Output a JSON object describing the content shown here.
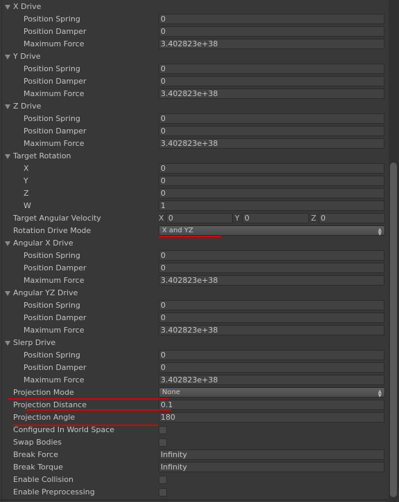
{
  "rows": [
    {
      "type": "foldout",
      "label": "X Drive"
    },
    {
      "type": "field",
      "label": "Position Spring",
      "value": "0"
    },
    {
      "type": "field",
      "label": "Position Damper",
      "value": "0"
    },
    {
      "type": "field",
      "label": "Maximum Force",
      "value": "3.402823e+38"
    },
    {
      "type": "foldout",
      "label": "Y Drive"
    },
    {
      "type": "field",
      "label": "Position Spring",
      "value": "0"
    },
    {
      "type": "field",
      "label": "Position Damper",
      "value": "0"
    },
    {
      "type": "field",
      "label": "Maximum Force",
      "value": "3.402823e+38"
    },
    {
      "type": "foldout",
      "label": "Z Drive"
    },
    {
      "type": "field",
      "label": "Position Spring",
      "value": "0"
    },
    {
      "type": "field",
      "label": "Position Damper",
      "value": "0"
    },
    {
      "type": "field",
      "label": "Maximum Force",
      "value": "3.402823e+38"
    },
    {
      "type": "foldout",
      "label": "Target Rotation"
    },
    {
      "type": "field",
      "label": "X",
      "value": "0"
    },
    {
      "type": "field",
      "label": "Y",
      "value": "0"
    },
    {
      "type": "field",
      "label": "Z",
      "value": "0"
    },
    {
      "type": "field",
      "label": "W",
      "value": "1"
    },
    {
      "type": "vector",
      "label": "Target Angular Velocity",
      "axes": [
        {
          "axis": "X",
          "value": "0"
        },
        {
          "axis": "Y",
          "value": "0"
        },
        {
          "axis": "Z",
          "value": "0"
        }
      ]
    },
    {
      "type": "popup",
      "label": "Rotation Drive Mode",
      "value": "X and YZ"
    },
    {
      "type": "foldout",
      "label": "Angular X Drive"
    },
    {
      "type": "field",
      "label": "Position Spring",
      "value": "0"
    },
    {
      "type": "field",
      "label": "Position Damper",
      "value": "0"
    },
    {
      "type": "field",
      "label": "Maximum Force",
      "value": "3.402823e+38"
    },
    {
      "type": "foldout",
      "label": "Angular YZ Drive"
    },
    {
      "type": "field",
      "label": "Position Spring",
      "value": "0"
    },
    {
      "type": "field",
      "label": "Position Damper",
      "value": "0"
    },
    {
      "type": "field",
      "label": "Maximum Force",
      "value": "3.402823e+38"
    },
    {
      "type": "foldout",
      "label": "Slerp Drive"
    },
    {
      "type": "field",
      "label": "Position Spring",
      "value": "0"
    },
    {
      "type": "field",
      "label": "Position Damper",
      "value": "0"
    },
    {
      "type": "field",
      "label": "Maximum Force",
      "value": "3.402823e+38"
    },
    {
      "type": "popup",
      "label": "Projection Mode",
      "value": "None",
      "top": true
    },
    {
      "type": "field",
      "label": "Projection Distance",
      "value": "0.1",
      "top": true
    },
    {
      "type": "field",
      "label": "Projection Angle",
      "value": "180",
      "top": true
    },
    {
      "type": "check",
      "label": "Configured In World Space",
      "checked": false
    },
    {
      "type": "check",
      "label": "Swap Bodies",
      "checked": false
    },
    {
      "type": "field",
      "label": "Break Force",
      "value": "Infinity",
      "top": true
    },
    {
      "type": "field",
      "label": "Break Torque",
      "value": "Infinity",
      "top": true
    },
    {
      "type": "check",
      "label": "Enable Collision",
      "checked": false
    },
    {
      "type": "check",
      "label": "Enable Preprocessing",
      "checked": false
    }
  ],
  "annotation_color": "#e00000"
}
